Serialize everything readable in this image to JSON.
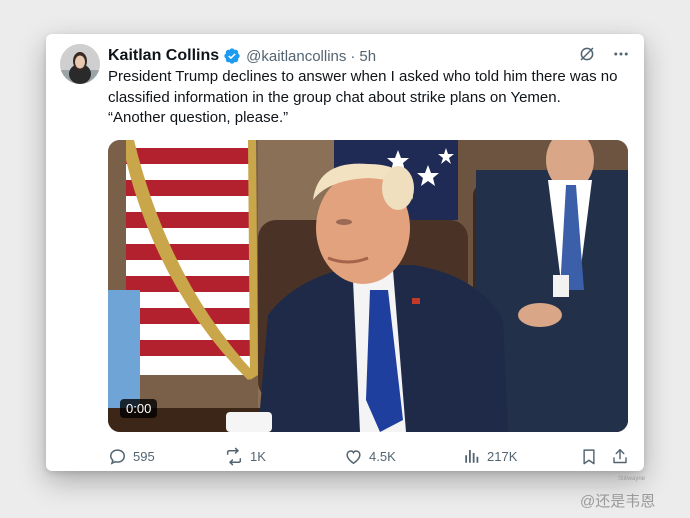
{
  "tweet": {
    "author_name": "Kaitlan Collins",
    "handle": "@kaitlancollins",
    "separator": "·",
    "time": "5h",
    "text_lines": [
      "President Trump declines to answer when I asked who told him there was no classified information in the group chat about strike plans on Yemen.",
      "“Another question, please.”"
    ]
  },
  "media": {
    "duration": "0:00"
  },
  "actions": {
    "replies": "595",
    "reposts": "1K",
    "likes": "4.5K",
    "views": "217K"
  },
  "corner_label": "Stillwayne",
  "watermark": "@还是韦恩",
  "icons": {
    "verified": "verified-badge-icon",
    "grok": "grok-icon",
    "more": "more-dots-icon",
    "reply": "reply-icon",
    "repost": "repost-icon",
    "like": "heart-icon",
    "views": "views-icon",
    "bookmark": "bookmark-icon",
    "share": "share-icon"
  },
  "colors": {
    "accent": "#1d9bf0",
    "text": "#0f1419",
    "muted": "#536471"
  }
}
